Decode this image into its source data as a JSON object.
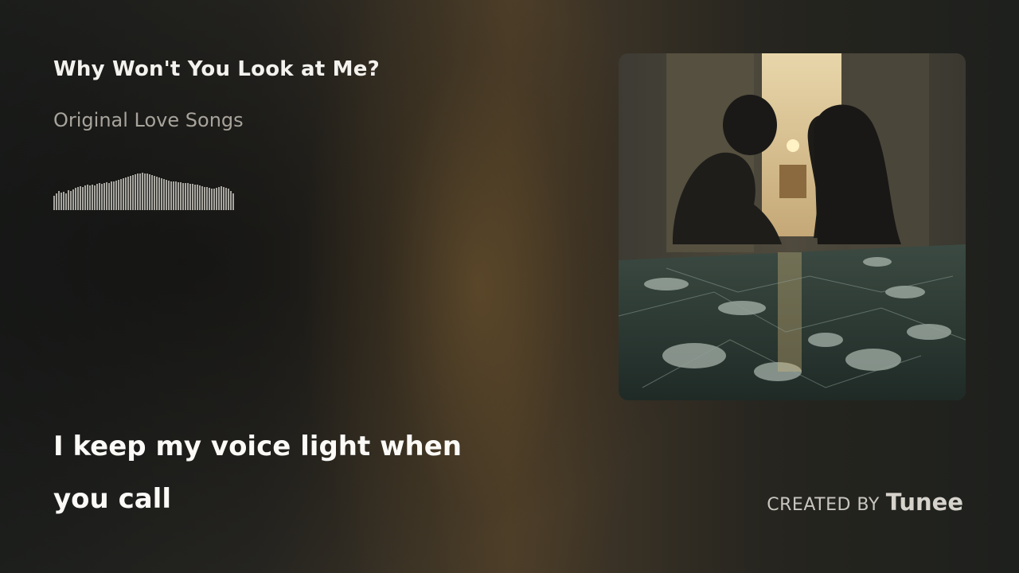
{
  "song": {
    "title": "Why Won't You Look at Me?",
    "album": "Original Love Songs"
  },
  "waveform": {
    "levels": [
      0.38,
      0.44,
      0.5,
      0.46,
      0.48,
      0.44,
      0.52,
      0.5,
      0.55,
      0.58,
      0.6,
      0.62,
      0.6,
      0.64,
      0.66,
      0.64,
      0.66,
      0.64,
      0.68,
      0.7,
      0.68,
      0.7,
      0.72,
      0.7,
      0.74,
      0.76,
      0.78,
      0.8,
      0.82,
      0.84,
      0.86,
      0.88,
      0.9,
      0.92,
      0.94,
      0.95,
      0.96,
      0.97,
      0.96,
      0.95,
      0.94,
      0.92,
      0.9,
      0.88,
      0.86,
      0.84,
      0.82,
      0.8,
      0.78,
      0.76,
      0.74,
      0.74,
      0.72,
      0.72,
      0.7,
      0.7,
      0.7,
      0.68,
      0.68,
      0.66,
      0.66,
      0.64,
      0.62,
      0.6,
      0.6,
      0.58,
      0.56,
      0.56,
      0.58,
      0.6,
      0.62,
      0.6,
      0.58,
      0.56,
      0.5,
      0.44
    ],
    "color": "#d8d5cf"
  },
  "cover": {
    "alt": "album-cover-art"
  },
  "lyrics": {
    "line1": "I keep my voice light when",
    "line2": "you call"
  },
  "credit": {
    "label": "CREATED BY",
    "brand": "Tunee"
  }
}
